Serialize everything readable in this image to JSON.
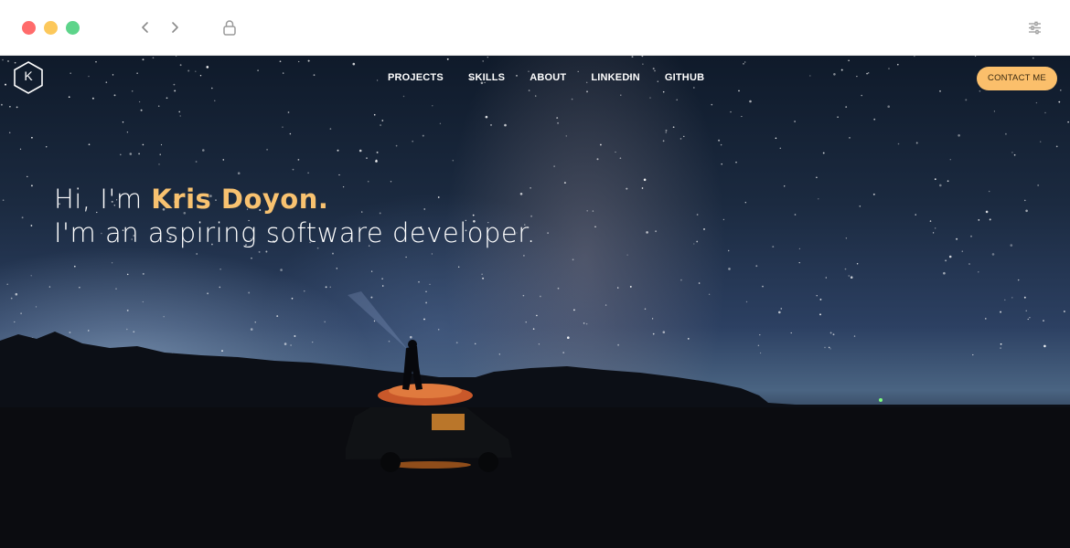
{
  "browser": {
    "traffic_lights": [
      "#ff6b6b",
      "#fcc85b",
      "#5dd48a"
    ],
    "icons": [
      "chevron-left-icon",
      "chevron-right-icon",
      "lock-icon",
      "sliders-icon"
    ]
  },
  "site": {
    "logo_letter": "K",
    "nav": [
      "PROJECTS",
      "SKILLS",
      "ABOUT",
      "LINKEDIN",
      "GITHUB"
    ],
    "contact_label": "CONTACT ME",
    "hero": {
      "greeting_prefix": "Hi, I'm ",
      "name": "Kris Doyon.",
      "tagline": "I'm an aspiring software developer."
    },
    "colors": {
      "accent": "#fbbf6b",
      "name_color": "#f8c270"
    }
  }
}
